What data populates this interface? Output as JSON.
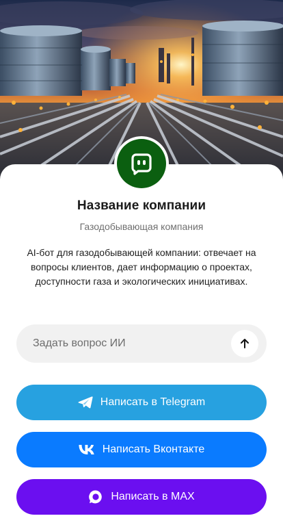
{
  "hero": {
    "image": "gas-plant-sunset-photo"
  },
  "company": {
    "avatar_icon": "chat-bot-icon",
    "avatar_color": "#0b5f10",
    "name": "Название компании",
    "subtitle": "Газодобывающая компания",
    "description": "AI-бот для газодобывающей компании: отвечает на вопросы клиентов, дает информацию о проектах, доступности газа и экологических инициативах."
  },
  "ask": {
    "placeholder": "Задать вопрос ИИ",
    "value": "",
    "send_icon": "arrow-up-icon"
  },
  "buttons": {
    "telegram": {
      "label": "Написать в Telegram",
      "icon": "telegram-icon",
      "color": "#27a1e0"
    },
    "vk": {
      "label": "Написать Вконтакте",
      "icon": "vk-icon",
      "color": "#0a7bff"
    },
    "max": {
      "label": "Написать в MAX",
      "icon": "max-icon",
      "color": "#6b0ff0"
    }
  }
}
